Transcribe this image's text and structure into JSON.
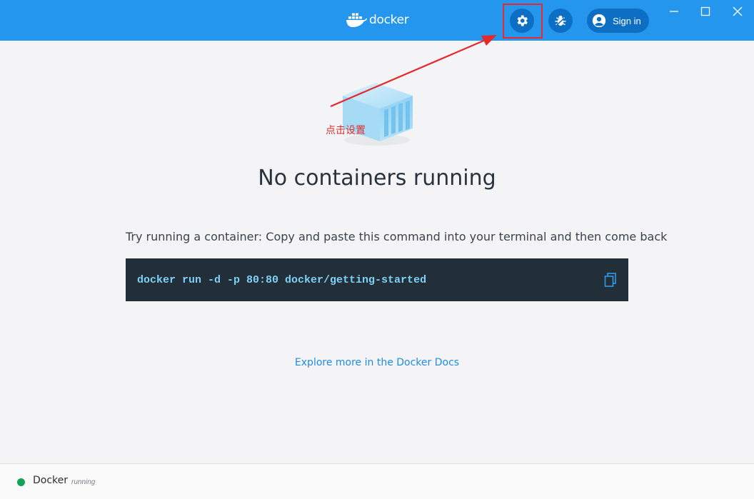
{
  "header": {
    "logo_text": "docker",
    "signin_label": "Sign in"
  },
  "annotation": {
    "text": "点击设置",
    "color": "#e32b2b"
  },
  "main": {
    "heading": "No containers running",
    "instruction": "Try running a container: Copy and paste this command into your terminal and then come back",
    "command": "docker run -d -p 80:80 docker/getting-started",
    "docs_link": "Explore more in the Docker Docs"
  },
  "footer": {
    "app_name": "Docker",
    "status": "running",
    "status_color": "#13a456"
  },
  "colors": {
    "titlebar": "#2496ed",
    "accent": "#0d6fc4",
    "command_bg": "#232f38"
  },
  "icons": [
    "docker-whale-icon",
    "gear-icon",
    "bug-icon",
    "user-icon",
    "minimize-icon",
    "maximize-icon",
    "close-icon",
    "copy-icon"
  ]
}
